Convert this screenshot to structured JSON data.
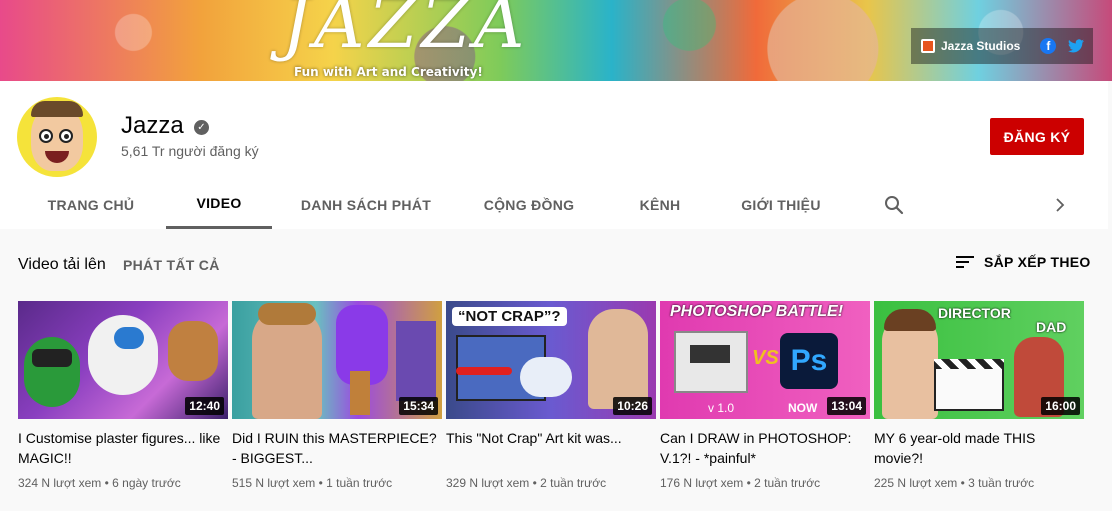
{
  "banner": {
    "title": "JAZZA",
    "tagline": "Fun with Art and Creativity!",
    "studio_link": "Jazza Studios",
    "facebook_letter": "f"
  },
  "channel": {
    "name": "Jazza",
    "subscribers": "5,61 Tr người đăng ký",
    "subscribe_label": "ĐĂNG KÝ"
  },
  "tabs": [
    {
      "label": "TRANG CHỦ",
      "active": false
    },
    {
      "label": "VIDEO",
      "active": true
    },
    {
      "label": "DANH SÁCH PHÁT",
      "active": false
    },
    {
      "label": "CỘNG ĐỒNG",
      "active": false
    },
    {
      "label": "KÊNH",
      "active": false
    },
    {
      "label": "GIỚI THIỆU",
      "active": false
    }
  ],
  "section": {
    "title": "Video tải lên",
    "play_all": "PHÁT TẤT CẢ",
    "sort_label": "SẮP XẾP THEO"
  },
  "videos": [
    {
      "title": "I Customise plaster figures... like MAGIC!!",
      "duration": "12:40",
      "views": "324 N lượt xem",
      "age": "6 ngày trước"
    },
    {
      "title": "Did I RUIN this MASTERPIECE? - BIGGEST...",
      "duration": "15:34",
      "views": "515 N lượt xem",
      "age": "1 tuần trước"
    },
    {
      "title": "This \"Not Crap\" Art kit was...",
      "duration": "10:26",
      "views": "329 N lượt xem",
      "age": "2 tuần trước"
    },
    {
      "title": "Can I DRAW in PHOTOSHOP: V.1?! - *painful*",
      "duration": "13:04",
      "views": "176 N lượt xem",
      "age": "2 tuần trước"
    },
    {
      "title": "MY 6 year-old made THIS movie?!",
      "duration": "16:00",
      "views": "225 N lượt xem",
      "age": "3 tuần trước"
    }
  ],
  "thumb_text": {
    "v3_caption": "“NOT CRAP”?",
    "v4_caption": "PHOTOSHOP BATTLE!",
    "v4_vs": "VS",
    "v4_ps": "Ps",
    "v4_version": "v 1.0",
    "v4_now": "NOW",
    "v5_director": "DIRECTOR",
    "v5_dad": "DAD"
  },
  "colors": {
    "subscribe_bg": "#cc0000",
    "text_primary": "#030303",
    "text_secondary": "#606060",
    "page_bg": "#f9f9f9"
  },
  "icons": [
    "verified-icon",
    "search-icon",
    "chevron-right-icon",
    "sort-icon",
    "facebook-icon",
    "twitter-icon",
    "studio-icon"
  ]
}
